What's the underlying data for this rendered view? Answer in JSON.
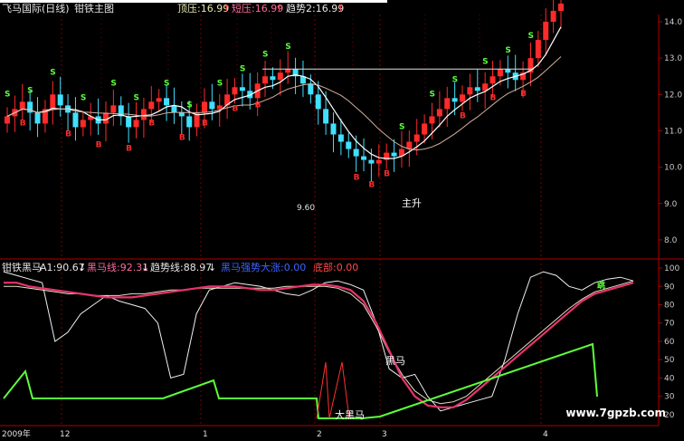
{
  "top_header": {
    "title": "飞马国际(日线)",
    "subtitle": "钳铁主图",
    "resist_label": "顶压:16.99",
    "short_label": "短压:16.99",
    "trend_label": "趋势2:16.99",
    "arrow": "↑"
  },
  "indicator_header": {
    "name": "钳铁黑马",
    "a1": "A1:90.67",
    "blackhorse": "黑马线:92.31",
    "trendline": "趋势线:88.97",
    "bhbig": "黑马强势大涨:0.00",
    "bottom": "底部:0.00",
    "arrow": "↓"
  },
  "price_axis": [
    "14.0",
    "13.0",
    "12.0",
    "11.0",
    "10.0",
    "9.0",
    "8.0"
  ],
  "ind_axis": [
    "100",
    "90",
    "80",
    "70",
    "60",
    "50",
    "40",
    "30",
    "20"
  ],
  "dates": [
    {
      "text": "2009年"
    },
    {
      "text": "12"
    },
    {
      "text": "1"
    },
    {
      "text": "2"
    },
    {
      "text": "3"
    },
    {
      "text": "4"
    }
  ],
  "annotations": {
    "zhusheng": "主升",
    "heima": "黑马",
    "daheima": "大黑马",
    "green_mark": "跳",
    "low_value": "9.60"
  },
  "signals": {
    "s": "S",
    "b": "B"
  },
  "watermark": "www.7gpzb.com",
  "colors": {
    "up": "#ff2a2a",
    "down": "#40e0ff",
    "grid": "#7a0000",
    "pink": "#e8336e",
    "green": "#5dff3a"
  },
  "chart_data": {
    "type": "line",
    "price_ylim": [
      7.5,
      14.2
    ],
    "indicator_ylim": [
      15,
      102
    ],
    "candles_close": [
      11.4,
      11.6,
      11.8,
      11.5,
      11.2,
      11.6,
      12.0,
      11.7,
      11.5,
      11.1,
      11.3,
      11.4,
      11.2,
      11.5,
      11.7,
      11.4,
      11.1,
      11.3,
      11.6,
      11.8,
      11.9,
      11.7,
      11.5,
      11.4,
      11.1,
      11.5,
      11.8,
      11.6,
      11.7,
      12.0,
      12.2,
      12.1,
      11.9,
      12.3,
      12.5,
      12.4,
      12.6,
      12.7,
      12.5,
      12.3,
      12.0,
      11.6,
      11.2,
      10.9,
      10.7,
      10.5,
      10.3,
      10.2,
      10.1,
      10.2,
      10.4,
      10.3,
      10.5,
      10.7,
      10.9,
      11.2,
      11.4,
      11.6,
      11.9,
      11.8,
      12.0,
      12.2,
      12.1,
      12.3,
      12.5,
      12.7,
      12.6,
      12.4,
      12.6,
      13.0,
      13.5,
      14.0,
      14.3,
      14.5
    ],
    "series": [
      {
        "name": "A1",
        "values": [
          98,
          96,
          94,
          92,
          60,
          65,
          75,
          80,
          85,
          82,
          80,
          78,
          70,
          40,
          42,
          75,
          88,
          90,
          92,
          91,
          90,
          88,
          86,
          85,
          88,
          92,
          93,
          91,
          88,
          70,
          45,
          40,
          42,
          30,
          22,
          24,
          26,
          28,
          30,
          50,
          75,
          95,
          98,
          96,
          90,
          88,
          92,
          94,
          95,
          93
        ]
      },
      {
        "name": "黑马线",
        "values": [
          92,
          92,
          90,
          89,
          88,
          87,
          86,
          85,
          84,
          84,
          84,
          85,
          86,
          87,
          88,
          89,
          90,
          90,
          90,
          89,
          88,
          88,
          89,
          90,
          91,
          91,
          90,
          88,
          82,
          70,
          55,
          40,
          30,
          25,
          24,
          24,
          28,
          34,
          40,
          46,
          52,
          58,
          64,
          70,
          76,
          82,
          86,
          88,
          90,
          92
        ]
      },
      {
        "name": "趋势线",
        "values": [
          90,
          90,
          89,
          88,
          87,
          86,
          86,
          85,
          85,
          85,
          86,
          86,
          87,
          88,
          88,
          89,
          89,
          89,
          89,
          89,
          89,
          89,
          90,
          90,
          90,
          90,
          89,
          86,
          80,
          68,
          54,
          42,
          33,
          28,
          26,
          27,
          30,
          36,
          42,
          48,
          54,
          60,
          66,
          72,
          78,
          83,
          87,
          89,
          91,
          93
        ]
      }
    ]
  }
}
